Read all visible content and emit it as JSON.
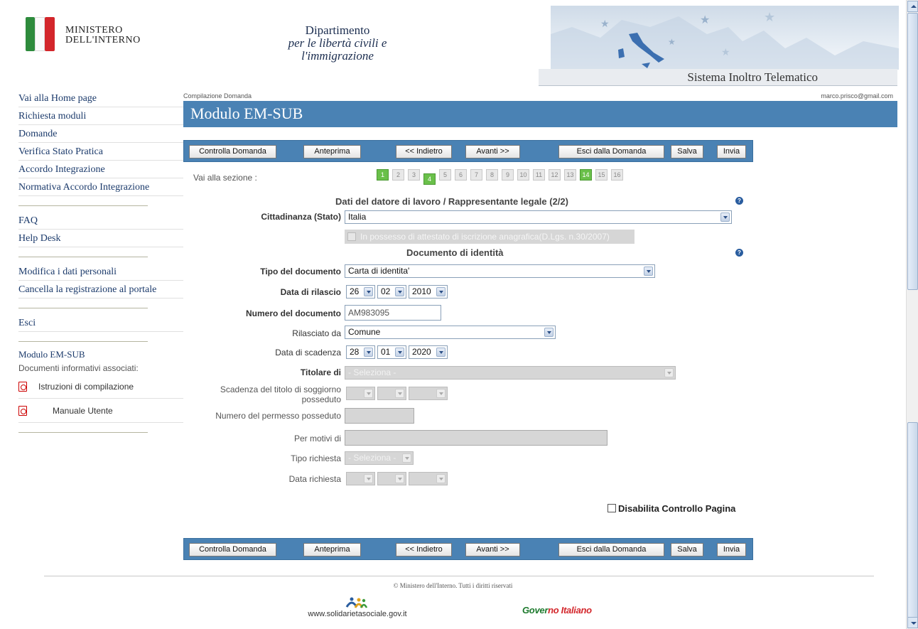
{
  "header": {
    "ministry_line1": "MINISTERO",
    "ministry_line2": "DELL'INTERNO",
    "dept_line1": "Dipartimento",
    "dept_line2": "per le libertà civili e",
    "dept_line3": "l'immigrazione",
    "system_name": "Sistema Inoltro Telematico"
  },
  "sidebar": {
    "group1": [
      "Vai alla Home page",
      "Richiesta moduli",
      "Domande",
      "Verifica Stato Pratica",
      "Accordo Integrazione",
      "Normativa Accordo Integrazione"
    ],
    "group2": [
      "FAQ",
      "Help Desk"
    ],
    "group3": [
      "Modifica i dati personali",
      "Cancella la registrazione al portale"
    ],
    "group4": [
      "Esci"
    ],
    "module_title": "Modulo EM-SUB",
    "docs_title": "Documenti informativi associati:",
    "docs": [
      "Istruzioni di compilazione",
      "Manuale Utente"
    ]
  },
  "main": {
    "breadcrumb": "Compilazione Domanda",
    "user_email": "marco.prisco@gmail.com",
    "title": "Modulo EM-SUB",
    "toolbar": {
      "check": "Controlla Domanda",
      "preview": "Anteprima",
      "back": "<< Indietro",
      "next": "Avanti >>",
      "exit": "Esci dalla Domanda",
      "save": "Salva",
      "send": "Invia"
    },
    "section_nav": {
      "label": "Vai alla sezione :",
      "pages": [
        "1",
        "2",
        "3",
        "4",
        "5",
        "6",
        "7",
        "8",
        "9",
        "10",
        "11",
        "12",
        "13",
        "14",
        "15",
        "16"
      ],
      "completed": [
        "1",
        "14"
      ],
      "current": "4"
    },
    "section1_title": "Dati del datore di lavoro / Rappresentante legale (2/2)",
    "section2_title": "Documento di identità",
    "help_symbol": "?",
    "fields": {
      "citizenship_label": "Cittadinanza (Stato)",
      "citizenship_value": "Italia",
      "attestation_label": "In possesso di attestato di iscrizione anagrafica(D.Lgs. n.30/2007)",
      "doc_type_label": "Tipo del documento",
      "doc_type_value": "Carta di identita'",
      "issue_date_label": "Data di rilascio",
      "issue_day": "26",
      "issue_month": "02",
      "issue_year": "2010",
      "doc_number_label": "Numero del documento",
      "doc_number_value": "AM983095",
      "issued_by_label": "Rilasciato da",
      "issued_by_value": "Comune",
      "expiry_date_label": "Data di scadenza",
      "expiry_day": "28",
      "expiry_month": "01",
      "expiry_year": "2020",
      "holder_label": "Titolare di",
      "holder_value": "- Seleziona -",
      "permit_expiry_label_1": "Scadenza del titolo di soggiorno",
      "permit_expiry_label_2": "posseduto",
      "permit_number_label": "Numero del permesso posseduto",
      "reason_label": "Per motivi di",
      "request_type_label": "Tipo richiesta",
      "request_type_value": "- Seleziona -",
      "request_date_label": "Data richiesta"
    },
    "disable_check_label": "Disabilita Controllo Pagina"
  },
  "footer": {
    "copyright": "© Ministero dell'Interno. Tutti i diritti riservati",
    "solidarity_site": "www.solidarietasociale.gov.it",
    "governo_part1": "Gover",
    "governo_part2": "no ",
    "governo_part3": "Italiano"
  },
  "colors": {
    "toolbar_blue": "#4a82b4",
    "completed_green": "#6ac04a",
    "flag_green": "#2e8b3c",
    "flag_red": "#d3262b"
  }
}
